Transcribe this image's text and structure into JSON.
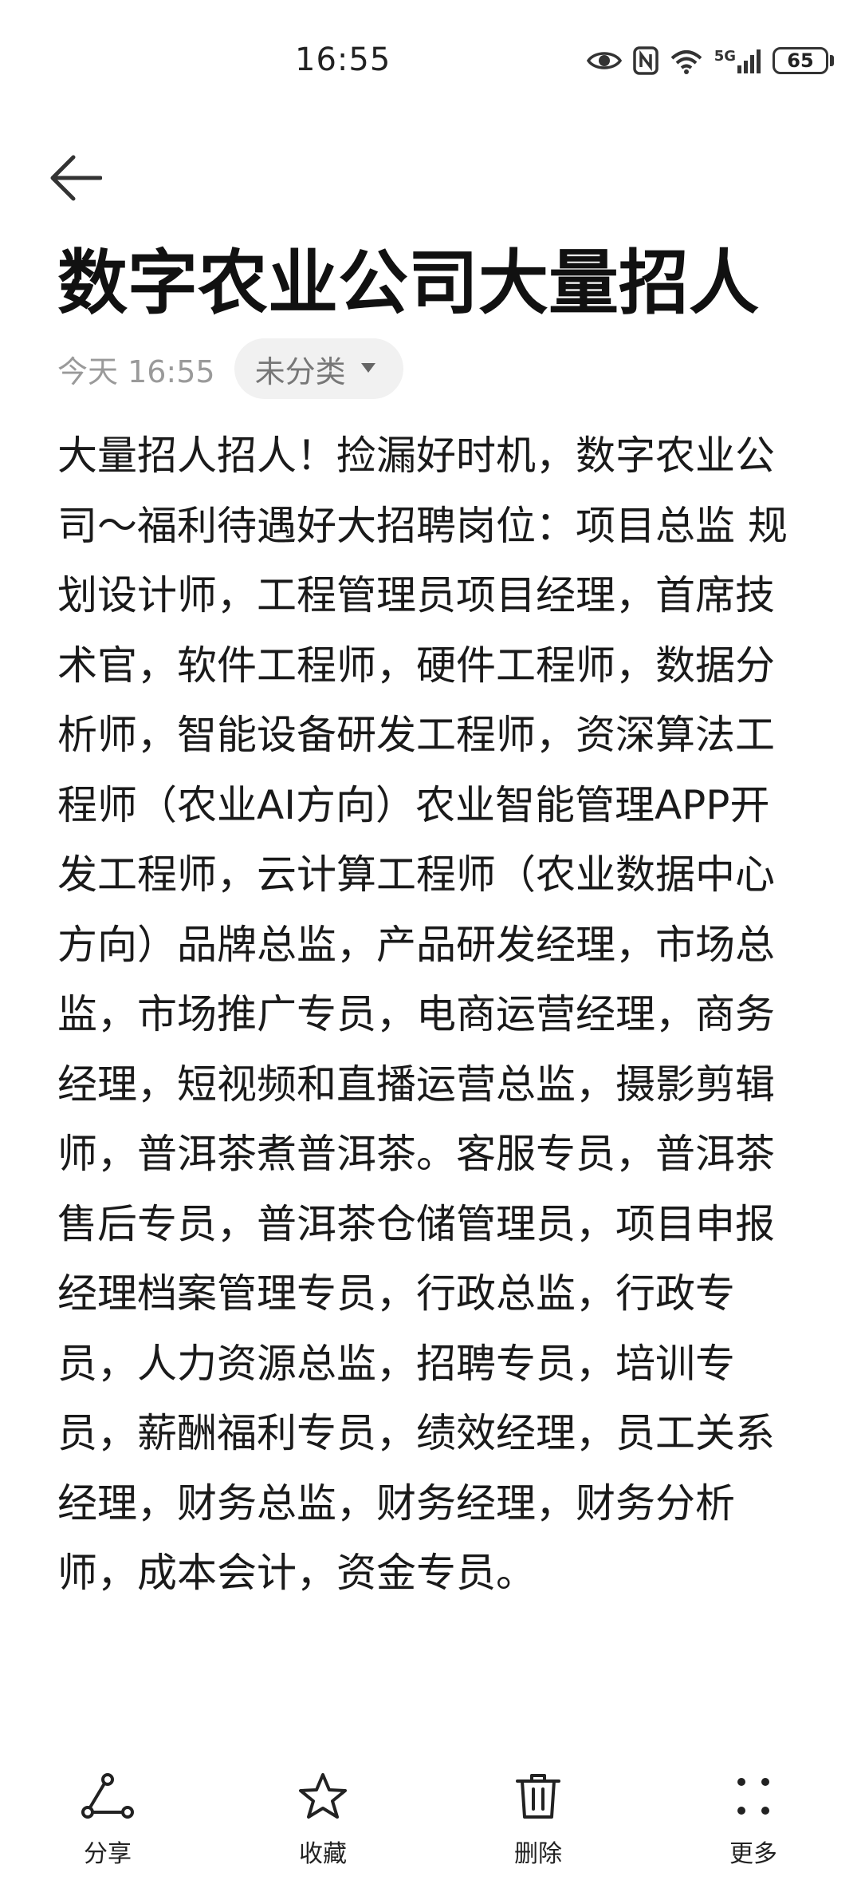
{
  "status_bar": {
    "time": "16:55",
    "battery": "65",
    "network": "5G"
  },
  "note": {
    "title": "数字农业公司大量招人",
    "date": "今天 16:55",
    "category": "未分类",
    "body": "大量招人招人！捡漏好时机，数字农业公司～福利待遇好大招聘岗位：项目总监 规划设计师，工程管理员项目经理，首席技术官，软件工程师，硬件工程师，数据分析师，智能设备研发工程师，资深算法工程师（农业AI方向）农业智能管理APP开发工程师，云计算工程师（农业数据中心方向）品牌总监，产品研发经理，市场总监，市场推广专员，电商运营经理，商务经理，短视频和直播运营总监，摄影剪辑师，普洱茶煮普洱茶。客服专员，普洱茶售后专员，普洱茶仓储管理员，项目申报经理档案管理专员，行政总监，行政专员，人力资源总监，招聘专员，培训专员，薪酬福利专员，绩效经理，员工关系经理，财务总监，财务经理，财务分析师，成本会计，资金专员。"
  },
  "bottom_bar": {
    "share": "分享",
    "favorite": "收藏",
    "delete": "删除",
    "more": "更多"
  },
  "icons": {
    "back": "arrow-left-icon",
    "share": "share-icon",
    "favorite": "star-icon",
    "delete": "trash-icon",
    "more": "more-dots-icon"
  }
}
